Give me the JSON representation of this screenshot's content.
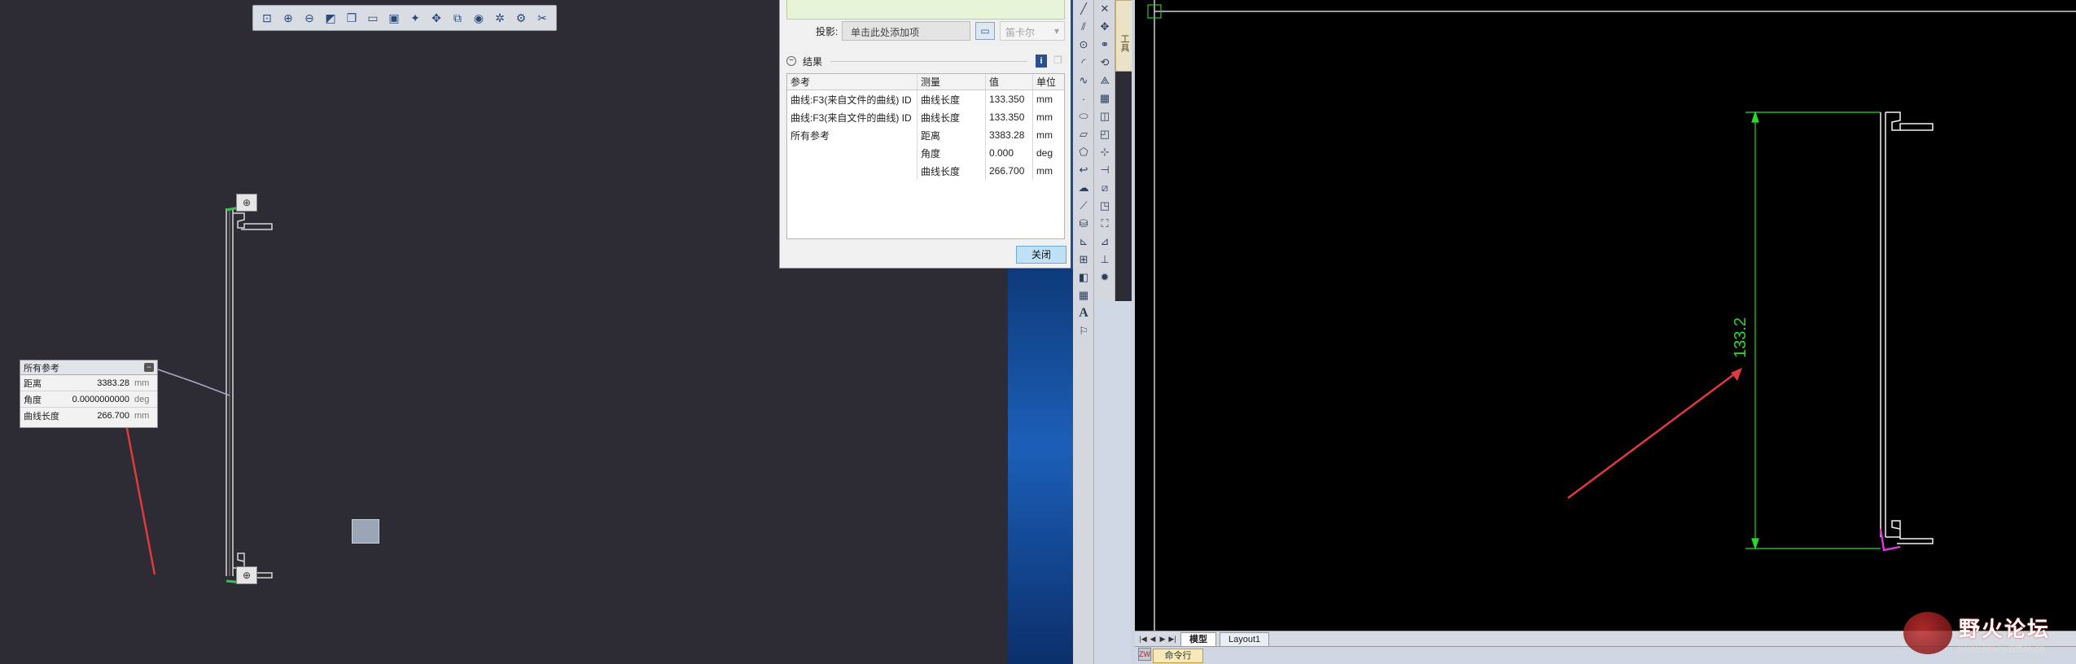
{
  "left_view": {
    "toolbar_icons": [
      "zoom-fit-icon",
      "zoom-in-icon",
      "zoom-out-icon",
      "zoom-window-icon",
      "view-cube-icon",
      "view-front-icon",
      "view-save-icon",
      "measure-icon",
      "rotate-icon",
      "section-icon",
      "sphere-icon",
      "render-icon",
      "settings-icon",
      "snap-icon"
    ],
    "info_box": {
      "title": "所有参考",
      "rows": [
        {
          "key": "距离",
          "value": "3383.28",
          "unit": "mm"
        },
        {
          "key": "角度",
          "value": "0.0000000000",
          "unit": "deg"
        },
        {
          "key": "曲线长度",
          "value": "266.700",
          "unit": "mm"
        }
      ]
    }
  },
  "dialog": {
    "projection_label": "投影:",
    "projection_placeholder": "单击此处添加项",
    "projection_mode": "笛卡尔",
    "results_title": "结果",
    "table": {
      "headers": [
        "参考",
        "测量",
        "值",
        "单位"
      ],
      "rows": [
        [
          "曲线:F3(来自文件的曲线) ID",
          "曲线长度",
          "133.350",
          "mm"
        ],
        [
          "曲线:F3(来自文件的曲线) ID",
          "曲线长度",
          "133.350",
          "mm"
        ],
        [
          "所有参考",
          "距离",
          "3383.28",
          "mm"
        ],
        [
          "",
          "角度",
          "0.000",
          "deg"
        ],
        [
          "",
          "曲线长度",
          "266.700",
          "mm"
        ]
      ]
    },
    "close_label": "关闭"
  },
  "cad": {
    "tab_strip_label": "工具",
    "dimension_text": "133.2",
    "layout_tabs": [
      "模型",
      "Layout1"
    ],
    "command_label": "命令行"
  },
  "watermark": {
    "title": "野火论坛",
    "url": "www.proewildfire.cn"
  }
}
